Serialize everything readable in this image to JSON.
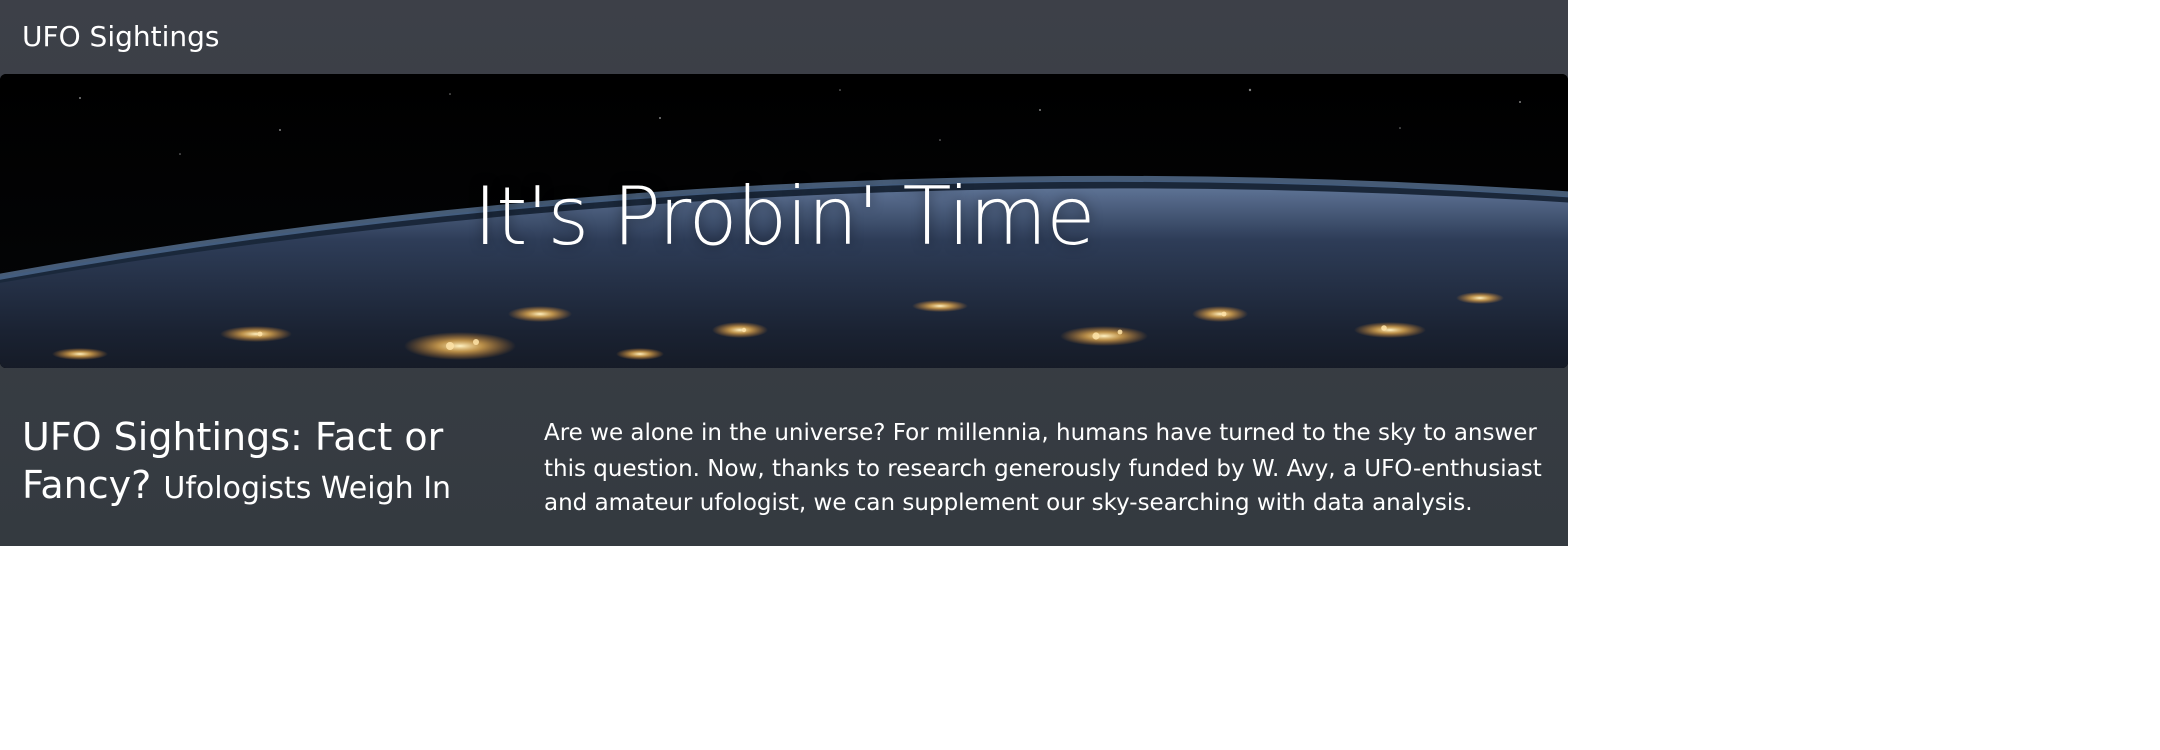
{
  "navbar": {
    "brand": "UFO Sightings"
  },
  "hero": {
    "title": "It's Probin' Time"
  },
  "article": {
    "headline_main": "UFO Sightings: Fact or Fancy?",
    "headline_sub": "Ufologists Weigh In",
    "intro": "Are we alone in the universe? For millennia, humans have turned to the sky to answer this question. Now, thanks to research generously funded by W. Avy, a UFO-enthusiast and amateur ufologist, we can supplement our sky-searching with data analysis."
  },
  "colors": {
    "navbar_bg": "#3d4048",
    "text": "#ffffff",
    "page_bg": "#ffffff",
    "city_lights": "#ffcc66"
  }
}
